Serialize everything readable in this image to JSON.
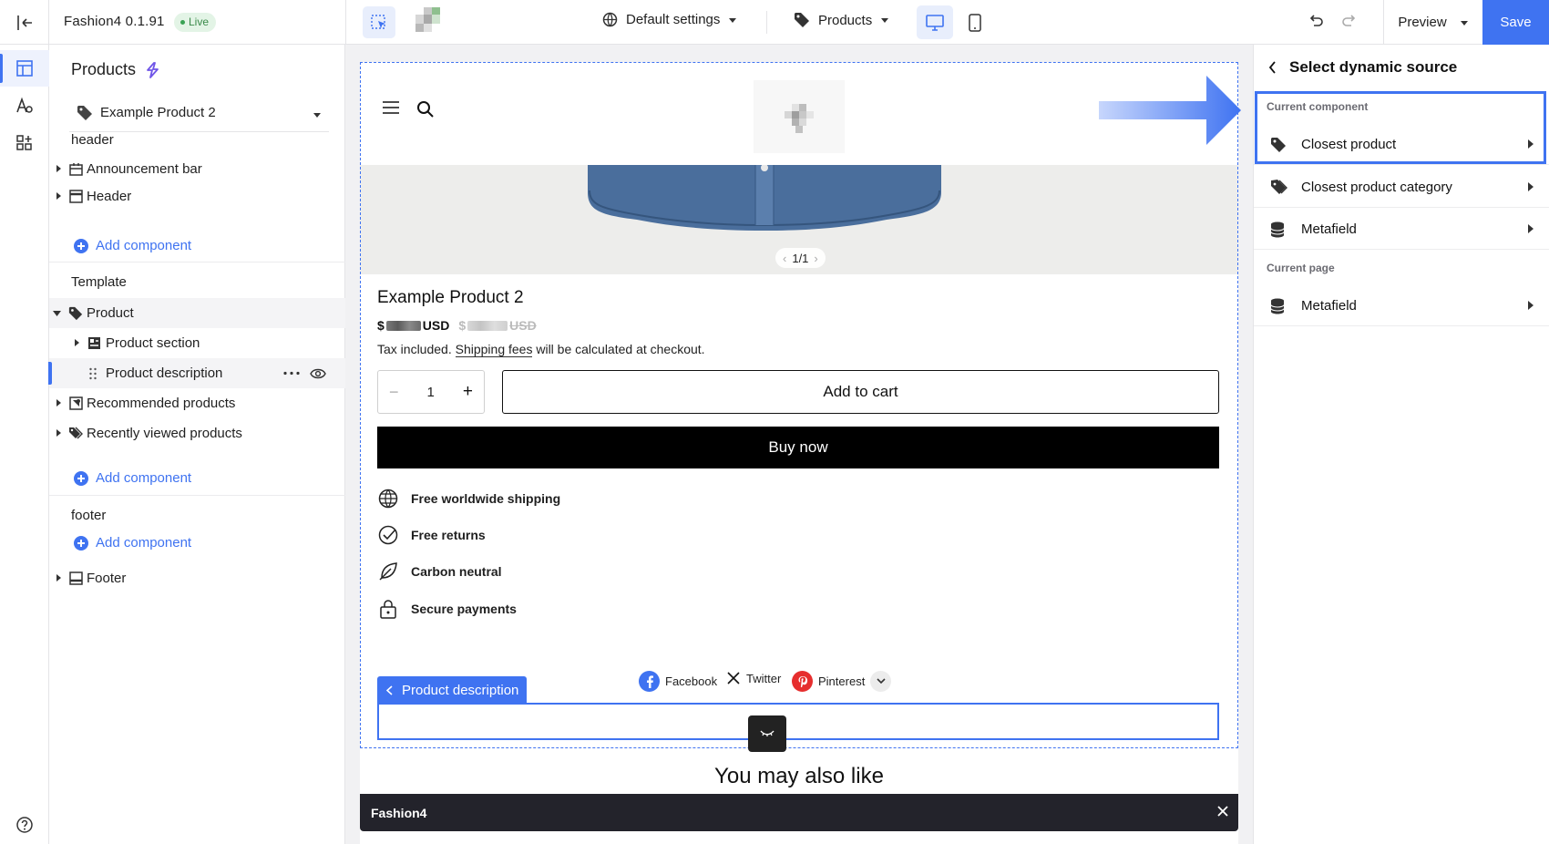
{
  "topbar": {
    "app_name": "Fashion4 0.1.91",
    "status": "Live",
    "settings_label": "Default settings",
    "products_label": "Products",
    "preview_label": "Preview",
    "save_label": "Save"
  },
  "left_panel": {
    "title": "Products",
    "selected_product": "Example Product 2",
    "groups": {
      "header": "header",
      "template": "Template",
      "footer": "footer"
    },
    "items": {
      "announcement_bar": "Announcement bar",
      "header": "Header",
      "product": "Product",
      "product_section": "Product section",
      "product_description": "Product description",
      "recommended": "Recommended products",
      "recently_viewed": "Recently viewed products",
      "footer": "Footer"
    },
    "add_component": "Add component"
  },
  "canvas": {
    "pager": "1/1",
    "product_title": "Example Product 2",
    "currency": "USD",
    "tax_text": "Tax included.",
    "shipping_link": "Shipping fees",
    "tax_text_end": "will be calculated at checkout.",
    "quantity": "1",
    "add_to_cart": "Add to cart",
    "buy_now": "Buy now",
    "features": [
      "Free worldwide shipping",
      "Free returns",
      "Carbon neutral",
      "Secure payments"
    ],
    "description_tab": "Product description",
    "share": {
      "facebook": "Facebook",
      "twitter": "Twitter",
      "pinterest": "Pinterest"
    },
    "you_may_also_like": "You may also like",
    "footer_bar": "Fashion4"
  },
  "right_panel": {
    "title": "Select dynamic source",
    "sections": {
      "current_component": "Current component",
      "current_page": "Current page"
    },
    "items": {
      "closest_product": "Closest product",
      "closest_category": "Closest product category",
      "metafield_component": "Metafield",
      "metafield_page": "Metafield"
    }
  },
  "colors": {
    "accent": "#3f73f1",
    "live_bg": "#e3f4e6",
    "buy_bg": "#000000",
    "footer_bar": "#23232b"
  }
}
